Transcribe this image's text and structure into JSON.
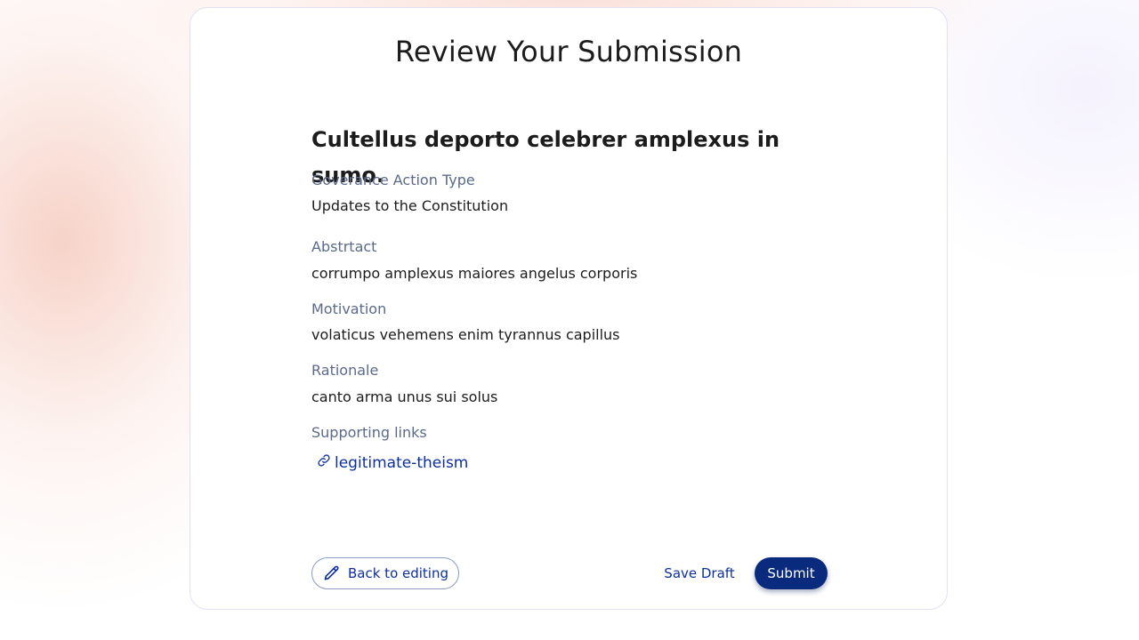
{
  "page": {
    "title": "Review Your Submission"
  },
  "submission": {
    "title": "Cultellus deporto celebrer amplexus in sumo.",
    "fields": [
      {
        "label": "Goverance Action Type",
        "value": "Updates to the Constitution"
      },
      {
        "label": "Abstrtact",
        "value": "corrumpo amplexus maiores angelus corporis"
      },
      {
        "label": "Motivation",
        "value": "volaticus vehemens enim tyrannus capillus"
      },
      {
        "label": "Rationale",
        "value": "canto arma unus sui solus"
      }
    ],
    "links_label": "Supporting links",
    "links": [
      {
        "text": "legitimate-theism",
        "icon": "link-icon"
      }
    ]
  },
  "actions": {
    "back_label": "Back to editing",
    "back_icon": "pencil-icon",
    "draft_label": "Save Draft",
    "submit_label": "Submit"
  },
  "colors": {
    "accent": "#0b2f9c",
    "submit_bg": "#0a2a7e",
    "label": "#5b6a8a",
    "text": "#1c1c1c"
  }
}
